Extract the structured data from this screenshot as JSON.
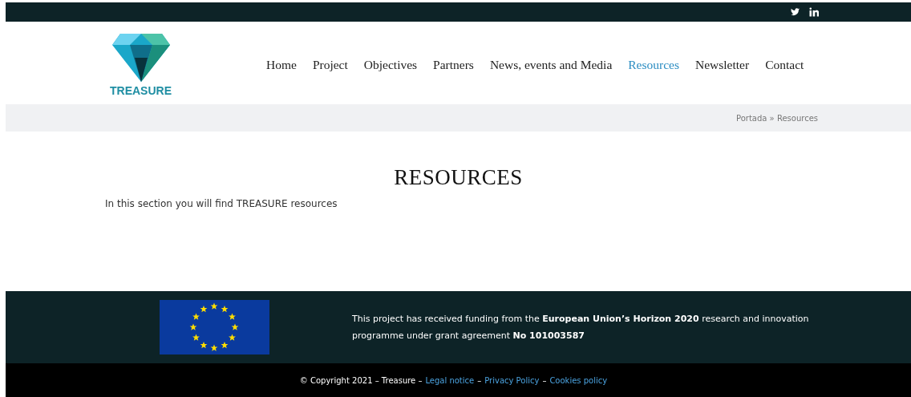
{
  "nav": {
    "logo_text": "TREASURE",
    "items": [
      {
        "label": "Home",
        "selected": false
      },
      {
        "label": "Project",
        "selected": false
      },
      {
        "label": "Objectives",
        "selected": false
      },
      {
        "label": "Partners",
        "selected": false
      },
      {
        "label": "News, events and Media",
        "selected": false
      },
      {
        "label": "Resources",
        "selected": true
      },
      {
        "label": "Newsletter",
        "selected": false
      },
      {
        "label": "Contact",
        "selected": false
      }
    ]
  },
  "breadcrumb": "Portada » Resources",
  "page": {
    "title": "RESOURCES",
    "intro": "In this section you will find TREASURE resources"
  },
  "funding": "This project has received funding from the **European Union’s Horizon 2020** research and innovation programme under grant agreement **No 101003587**",
  "copyright": [
    {
      "kind": "text",
      "text": "© Copyright 2021 – Treasure –"
    },
    {
      "kind": "link",
      "text": "Legal notice"
    },
    {
      "kind": "text",
      "text": "–"
    },
    {
      "kind": "link",
      "text": "Privacy Policy"
    },
    {
      "kind": "text",
      "text": "–"
    },
    {
      "kind": "link",
      "text": "Cookies policy"
    }
  ]
}
